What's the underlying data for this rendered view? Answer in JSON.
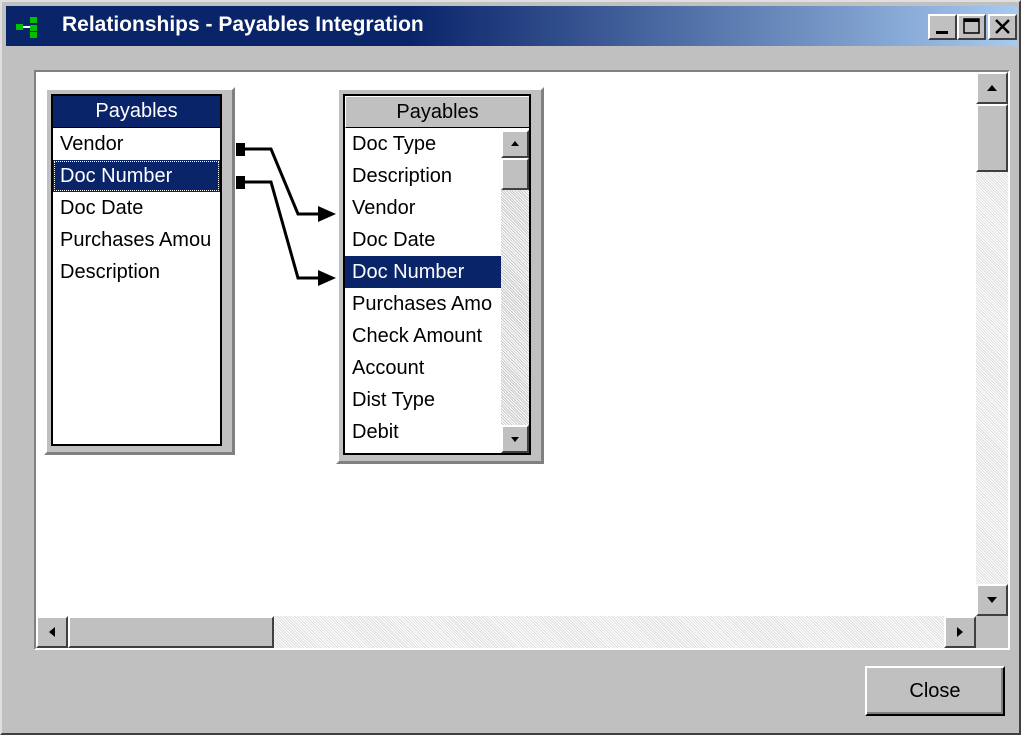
{
  "window": {
    "title": "Relationships - Payables Integration",
    "icon": "app-relationships-icon",
    "controls": [
      "minimize-icon",
      "maximize-icon",
      "close-icon"
    ],
    "accent": "#0a246a"
  },
  "source_table": {
    "title": "Payables",
    "fields": [
      "Vendor",
      "Doc Number",
      "Doc Date",
      "Purchases Amou",
      "Description"
    ],
    "selected": "Doc Number"
  },
  "target_table": {
    "title": "Payables",
    "fields": [
      "Doc Type",
      "Description",
      "Vendor",
      "Doc Date",
      "Doc Number",
      "Purchases Amo",
      "Check Amount",
      "Account",
      "Dist Type",
      "Debit"
    ],
    "selected": "Doc Number"
  },
  "relationships": [
    {
      "from": "Vendor",
      "to": "Vendor"
    },
    {
      "from": "Doc Number",
      "to": "Doc Number"
    }
  ],
  "buttons": {
    "close_label": "Close"
  }
}
